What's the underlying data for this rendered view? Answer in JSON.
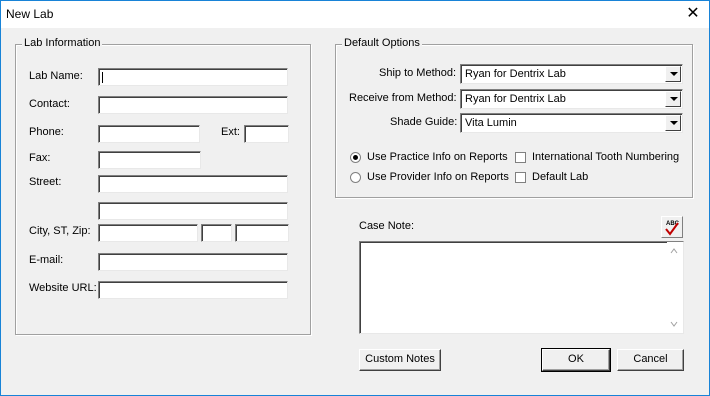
{
  "window": {
    "title": "New Lab"
  },
  "lab_info": {
    "legend": "Lab Information",
    "name_label": "Lab Name:",
    "contact_label": "Contact:",
    "phone_label": "Phone:",
    "ext_label": "Ext:",
    "fax_label": "Fax:",
    "street_label": "Street:",
    "city_label": "City, ST, Zip:",
    "email_label": "E-mail:",
    "website_label": "Website URL:"
  },
  "defaults": {
    "legend": "Default Options",
    "ship_label": "Ship to Method:",
    "ship_value": "Ryan for Dentrix Lab",
    "receive_label": "Receive from Method:",
    "receive_value": "Ryan for Dentrix Lab",
    "shade_label": "Shade Guide:",
    "shade_value": "Vita Lumin",
    "radio_practice": "Use Practice Info on Reports",
    "radio_provider": "Use Provider Info on Reports",
    "check_intl": "International Tooth Numbering",
    "check_default": "Default Lab"
  },
  "case_note": {
    "label": "Case Note:",
    "spell_icon_text": "ABC"
  },
  "buttons": {
    "custom_notes": "Custom Notes",
    "ok": "OK",
    "cancel": "Cancel"
  },
  "icons": {
    "close": "close-icon",
    "spell": "spellcheck-icon"
  },
  "colors": {
    "window_border": "#1883d7",
    "face": "#f0f0f0",
    "check_mark": "#c00000"
  }
}
